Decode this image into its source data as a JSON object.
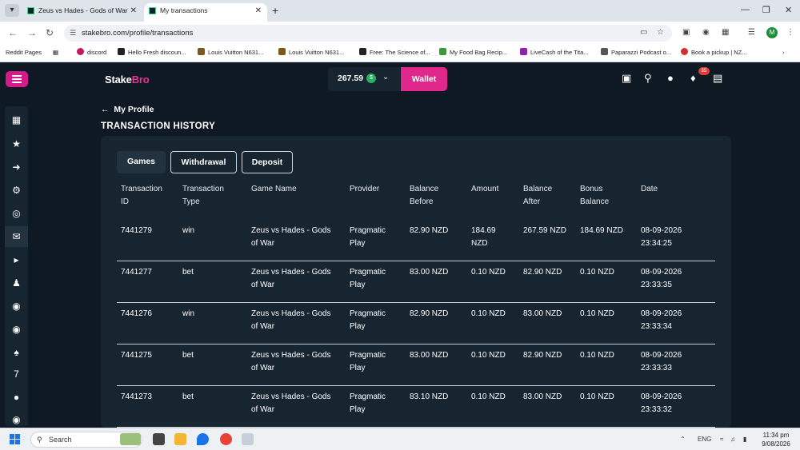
{
  "browser": {
    "tabs": [
      {
        "title": "Zeus vs Hades - Gods of War | S",
        "active": false
      },
      {
        "title": "My transactions",
        "active": true
      }
    ],
    "url": "stakebro.com/profile/transactions",
    "profile_initial": "M",
    "bookmarks": [
      "Reddit Pages",
      "discord",
      "Hello Fresh discoun...",
      "Louis Vuitton N631...",
      "Louis Vuitton N631...",
      "Free: The Science of...",
      "My Food Bag Recip...",
      "LiveCash of the Tita...",
      "Paparazzi Podcast o...",
      "Book a pickup | NZ..."
    ]
  },
  "header": {
    "logo_prefix": "Stake",
    "logo_suffix": "Bro",
    "balance": "267.59",
    "currency_symbol": "$",
    "wallet_label": "Wallet",
    "notification_count": "65"
  },
  "page": {
    "back_label": "My Profile",
    "title": "TRANSACTION HISTORY"
  },
  "filters": [
    {
      "label": "Games",
      "active": true
    },
    {
      "label": "Withdrawal",
      "active": false
    },
    {
      "label": "Deposit",
      "active": false
    }
  ],
  "table": {
    "columns": [
      [
        "Transaction",
        "ID"
      ],
      [
        "Transaction",
        "Type"
      ],
      [
        "Game Name",
        ""
      ],
      [
        "Provider",
        ""
      ],
      [
        "Balance",
        "Before"
      ],
      [
        "Amount",
        ""
      ],
      [
        "Balance",
        "After"
      ],
      [
        "Bonus",
        "Balance"
      ],
      [
        "Date",
        ""
      ]
    ],
    "rows": [
      {
        "id": "7441279",
        "type": "win",
        "game": [
          "Zeus vs Hades - Gods",
          "of War"
        ],
        "provider": [
          "Pragmatic",
          "Play"
        ],
        "before": "82.90 NZD",
        "amount": [
          "184.69",
          "NZD"
        ],
        "after": "267.59 NZD",
        "bonus": "184.69 NZD",
        "date": [
          "08-09-2026",
          "23:34:25"
        ]
      },
      {
        "id": "7441277",
        "type": "bet",
        "game": [
          "Zeus vs Hades - Gods",
          "of War"
        ],
        "provider": [
          "Pragmatic",
          "Play"
        ],
        "before": "83.00 NZD",
        "amount": [
          "0.10 NZD",
          ""
        ],
        "after": "82.90 NZD",
        "bonus": "0.10 NZD",
        "date": [
          "08-09-2026",
          "23:33:35"
        ]
      },
      {
        "id": "7441276",
        "type": "win",
        "game": [
          "Zeus vs Hades - Gods",
          "of War"
        ],
        "provider": [
          "Pragmatic",
          "Play"
        ],
        "before": "82.90 NZD",
        "amount": [
          "0.10 NZD",
          ""
        ],
        "after": "83.00 NZD",
        "bonus": "0.10 NZD",
        "date": [
          "08-09-2026",
          "23:33:34"
        ]
      },
      {
        "id": "7441275",
        "type": "bet",
        "game": [
          "Zeus vs Hades - Gods",
          "of War"
        ],
        "provider": [
          "Pragmatic",
          "Play"
        ],
        "before": "83.00 NZD",
        "amount": [
          "0.10 NZD",
          ""
        ],
        "after": "82.90 NZD",
        "bonus": "0.10 NZD",
        "date": [
          "08-09-2026",
          "23:33:33"
        ]
      },
      {
        "id": "7441273",
        "type": "bet",
        "game": [
          "Zeus vs Hades - Gods",
          "of War"
        ],
        "provider": [
          "Pragmatic",
          "Play"
        ],
        "before": "83.10 NZD",
        "amount": [
          "0.10 NZD",
          ""
        ],
        "after": "83.00 NZD",
        "bonus": "0.10 NZD",
        "date": [
          "08-09-2026",
          "23:33:32"
        ]
      }
    ]
  },
  "taskbar": {
    "search_placeholder": "Search",
    "language": "ENG",
    "time": "11:34 pm",
    "date": "9/08/2026"
  },
  "colors": {
    "accent": "#e0288c",
    "background": "#0f1923",
    "panel": "#172531"
  }
}
